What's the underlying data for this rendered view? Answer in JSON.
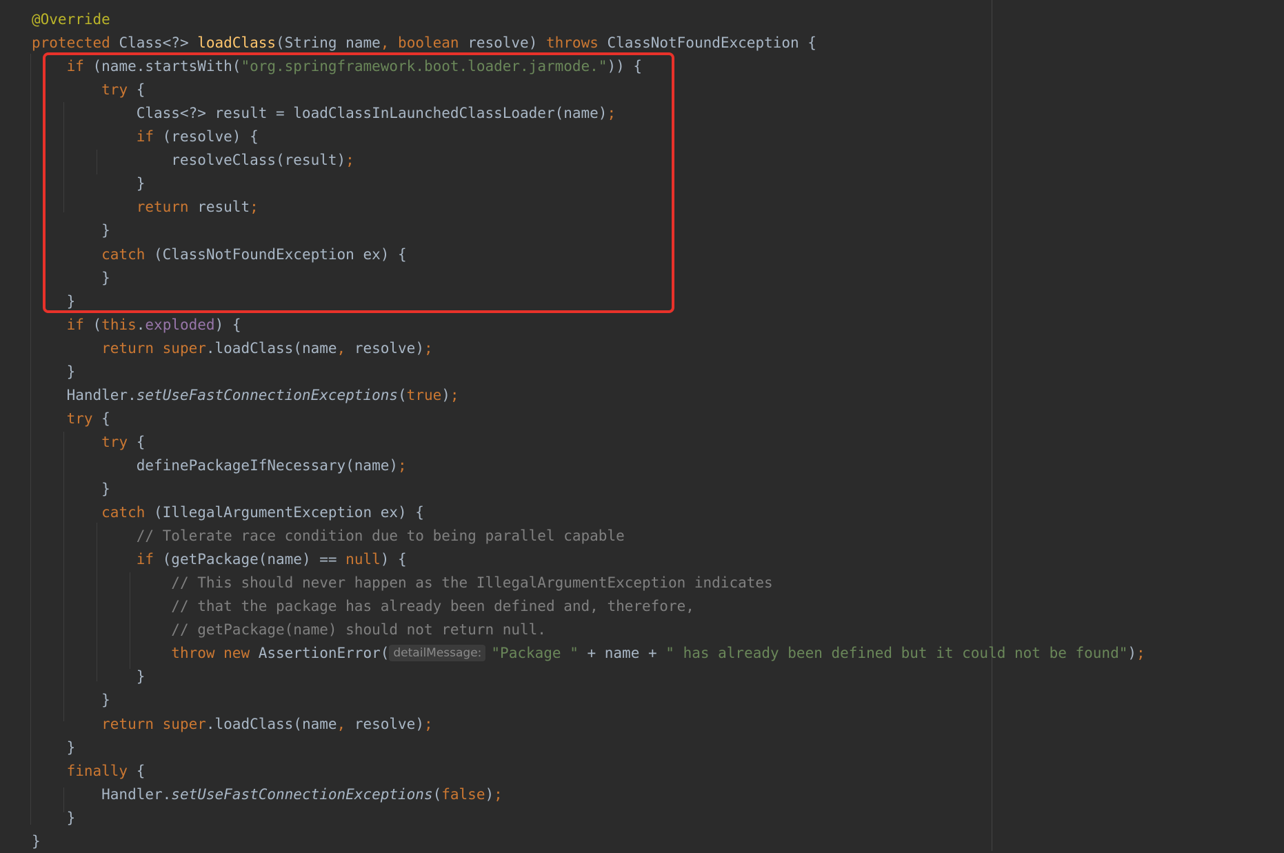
{
  "editor": {
    "lines": [
      [
        [
          "ann",
          "@Override"
        ]
      ],
      [
        [
          "kw",
          "protected "
        ],
        [
          "",
          "Class<?> "
        ],
        [
          "fn",
          "loadClass"
        ],
        [
          "",
          "(String name"
        ],
        [
          "kw",
          ", "
        ],
        [
          "kw",
          "boolean "
        ],
        [
          "",
          "resolve) "
        ],
        [
          "kw",
          "throws "
        ],
        [
          "",
          "ClassNotFoundException {"
        ]
      ],
      [
        [
          "",
          "    "
        ],
        [
          "kw",
          "if "
        ],
        [
          "",
          "(name.startsWith("
        ],
        [
          "str",
          "\"org.springframework.boot.loader.jarmode.\""
        ],
        [
          "",
          ")) {"
        ]
      ],
      [
        [
          "",
          "        "
        ],
        [
          "kw",
          "try "
        ],
        [
          "",
          "{"
        ]
      ],
      [
        [
          "",
          "            Class<?> result = loadClassInLaunchedClassLoader(name)"
        ],
        [
          "kw",
          ";"
        ]
      ],
      [
        [
          "",
          "            "
        ],
        [
          "kw",
          "if "
        ],
        [
          "",
          "(resolve) {"
        ]
      ],
      [
        [
          "",
          "                resolveClass(result)"
        ],
        [
          "kw",
          ";"
        ]
      ],
      [
        [
          "",
          "            }"
        ]
      ],
      [
        [
          "",
          "            "
        ],
        [
          "kw",
          "return "
        ],
        [
          "",
          "result"
        ],
        [
          "kw",
          ";"
        ]
      ],
      [
        [
          "",
          "        }"
        ]
      ],
      [
        [
          "",
          "        "
        ],
        [
          "kw",
          "catch "
        ],
        [
          "",
          "(ClassNotFoundException ex) {"
        ]
      ],
      [
        [
          "",
          "        }"
        ]
      ],
      [
        [
          "",
          "    }"
        ]
      ],
      [
        [
          "",
          "    "
        ],
        [
          "kw",
          "if "
        ],
        [
          "",
          "("
        ],
        [
          "kw",
          "this"
        ],
        [
          "",
          "."
        ],
        [
          "fld",
          "exploded"
        ],
        [
          "",
          ") {"
        ]
      ],
      [
        [
          "",
          "        "
        ],
        [
          "kw",
          "return super"
        ],
        [
          "",
          ".loadClass(name"
        ],
        [
          "kw",
          ", "
        ],
        [
          "",
          "resolve)"
        ],
        [
          "kw",
          ";"
        ]
      ],
      [
        [
          "",
          "    }"
        ]
      ],
      [
        [
          "",
          "    Handler."
        ],
        [
          "it",
          "setUseFastConnectionExceptions"
        ],
        [
          "",
          "("
        ],
        [
          "kw",
          "true"
        ],
        [
          "",
          ")"
        ],
        [
          "kw",
          ";"
        ]
      ],
      [
        [
          "",
          "    "
        ],
        [
          "kw",
          "try "
        ],
        [
          "",
          "{"
        ]
      ],
      [
        [
          "",
          "        "
        ],
        [
          "kw",
          "try "
        ],
        [
          "",
          "{"
        ]
      ],
      [
        [
          "",
          "            definePackageIfNecessary(name)"
        ],
        [
          "kw",
          ";"
        ]
      ],
      [
        [
          "",
          "        }"
        ]
      ],
      [
        [
          "",
          "        "
        ],
        [
          "kw",
          "catch "
        ],
        [
          "",
          "(IllegalArgumentException ex) {"
        ]
      ],
      [
        [
          "",
          "            "
        ],
        [
          "cm",
          "// Tolerate race condition due to being parallel capable"
        ]
      ],
      [
        [
          "",
          "            "
        ],
        [
          "kw",
          "if "
        ],
        [
          "",
          "(getPackage(name) == "
        ],
        [
          "kw",
          "null"
        ],
        [
          "",
          ") {"
        ]
      ],
      [
        [
          "",
          "                "
        ],
        [
          "cm",
          "// This should never happen as the IllegalArgumentException indicates"
        ]
      ],
      [
        [
          "",
          "                "
        ],
        [
          "cm",
          "// that the package has already been defined and, therefore,"
        ]
      ],
      [
        [
          "",
          "                "
        ],
        [
          "cm",
          "// getPackage(name) should not return null."
        ]
      ],
      [
        [
          "",
          "                "
        ],
        [
          "kw",
          "throw new "
        ],
        [
          "",
          "AssertionError("
        ],
        [
          "hint",
          "detailMessage:"
        ],
        [
          "str",
          "\"Package \""
        ],
        [
          "",
          " + name + "
        ],
        [
          "str",
          "\" has already been defined but it could not be found\""
        ],
        [
          "",
          ")"
        ],
        [
          "kw",
          ";"
        ]
      ],
      [
        [
          "",
          "            }"
        ]
      ],
      [
        [
          "",
          "        }"
        ]
      ],
      [
        [
          "",
          "        "
        ],
        [
          "kw",
          "return super"
        ],
        [
          "",
          ".loadClass(name"
        ],
        [
          "kw",
          ", "
        ],
        [
          "",
          "resolve)"
        ],
        [
          "kw",
          ";"
        ]
      ],
      [
        [
          "",
          "    }"
        ]
      ],
      [
        [
          "",
          "    "
        ],
        [
          "kw",
          "finally "
        ],
        [
          "",
          "{"
        ]
      ],
      [
        [
          "",
          "        Handler."
        ],
        [
          "it",
          "setUseFastConnectionExceptions"
        ],
        [
          "",
          "("
        ],
        [
          "kw",
          "false"
        ],
        [
          "",
          ")"
        ],
        [
          "kw",
          ";"
        ]
      ],
      [
        [
          "",
          "    }"
        ]
      ],
      [
        [
          "",
          "}"
        ]
      ]
    ]
  },
  "colors": {
    "background": "#2b2b2b",
    "keyword": "#cc7832",
    "annotation": "#bbb529",
    "method": "#ffc66d",
    "string": "#6a8759",
    "comment": "#808080",
    "field": "#9876aa",
    "highlight_border": "#e8322a"
  }
}
